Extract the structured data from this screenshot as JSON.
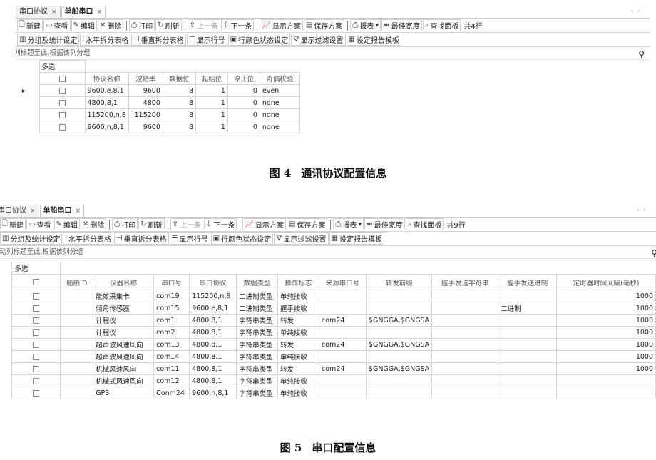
{
  "toolbar": {
    "new": "新建",
    "view": "查看",
    "edit": "编辑",
    "delete": "删除",
    "print": "打印",
    "refresh": "刷新",
    "prev": "上一条",
    "next": "下一条",
    "show_scheme": "显示方案",
    "save_scheme": "保存方案",
    "report": "报表",
    "best_width": "最佳宽度",
    "find_panel": "查找面板",
    "group_stats": "分组及统计设定",
    "h_split": "水平拆分表格",
    "v_split": "垂直拆分表格",
    "show_rownum": "显示行号",
    "row_color": "行颜色状态设定",
    "show_filter": "显示过滤设置",
    "report_template": "设定报告模板"
  },
  "group_hint": "拖动列标题至此,根据该列分组",
  "multi_select_label": "多选",
  "panel1": {
    "tabs": [
      {
        "label": "串口协议",
        "close": "×"
      },
      {
        "label": "单船串口",
        "close": "×"
      }
    ],
    "row_count": "共4行",
    "headers": [
      "协议名称",
      "波特率",
      "数据位",
      "起始位",
      "停止位",
      "奇偶校验"
    ],
    "current_row_marker": "▸",
    "rows": [
      [
        "9600,e,8,1",
        "9600",
        "8",
        "1",
        "0",
        "even"
      ],
      [
        "4800,8,1",
        "4800",
        "8",
        "1",
        "0",
        "none"
      ],
      [
        "115200,n,8",
        "115200",
        "8",
        "1",
        "0",
        "none"
      ],
      [
        "9600,n,8,1",
        "9600",
        "8",
        "1",
        "0",
        "none"
      ]
    ]
  },
  "caption1": {
    "label": "图 4",
    "text": "通讯协议配置信息"
  },
  "panel2": {
    "tabs": [
      {
        "label": "串口协议",
        "close": "×"
      },
      {
        "label": "单船串口",
        "close": "×"
      }
    ],
    "row_count": "共9行",
    "headers": [
      "船舶ID",
      "仪器名称",
      "串口号",
      "串口协议",
      "数据类型",
      "操作标志",
      "来源串口号",
      "转发前缀",
      "握手发送字符串",
      "握手发送进制",
      "定时器时间间隔(毫秒)"
    ],
    "rows": [
      [
        "",
        "能效采集卡",
        "com19",
        "115200,n,8",
        "二进制类型",
        "单纯接收",
        "",
        "",
        "",
        "",
        "1000"
      ],
      [
        "",
        "倾角传感器",
        "com15",
        "9600,e,8,1",
        "二进制类型",
        "握手接收",
        "",
        "",
        "",
        "二进制",
        "1000"
      ],
      [
        "",
        "计程仪",
        "com1",
        "4800,8,1",
        "字符串类型",
        "转发",
        "com24",
        "$GNGGA,$GNGSA",
        "",
        "",
        "1000"
      ],
      [
        "",
        "计程仪",
        "com2",
        "4800,8,1",
        "字符串类型",
        "单纯接收",
        "",
        "",
        "",
        "",
        "1000"
      ],
      [
        "",
        "超声波风速风向",
        "com13",
        "4800,8,1",
        "字符串类型",
        "转发",
        "com24",
        "$GNGGA,$GNGSA",
        "",
        "",
        "1000"
      ],
      [
        "",
        "超声波风速风向",
        "com14",
        "4800,8,1",
        "字符串类型",
        "单纯接收",
        "",
        "",
        "",
        "",
        "1000"
      ],
      [
        "",
        "机械风速风向",
        "com11",
        "4800,8,1",
        "字符串类型",
        "转发",
        "com24",
        "$GNGGA,$GNGSA",
        "",
        "",
        "1000"
      ],
      [
        "",
        "机械式风速风向",
        "com12",
        "4800,8,1",
        "字符串类型",
        "单纯接收",
        "",
        "",
        "",
        "",
        ""
      ],
      [
        "",
        "GPS",
        "Conm24",
        "9600,n,8,1",
        "字符串类型",
        "单纯接收",
        "",
        "",
        "",
        "",
        ""
      ]
    ]
  },
  "caption2": {
    "label": "图 5",
    "text": "串口配置信息"
  },
  "icons": {
    "new": "new-doc-icon",
    "view": "view-icon",
    "edit": "edit-icon",
    "delete": "delete-icon",
    "print": "printer-icon",
    "refresh": "refresh-icon",
    "search": "search-icon"
  }
}
